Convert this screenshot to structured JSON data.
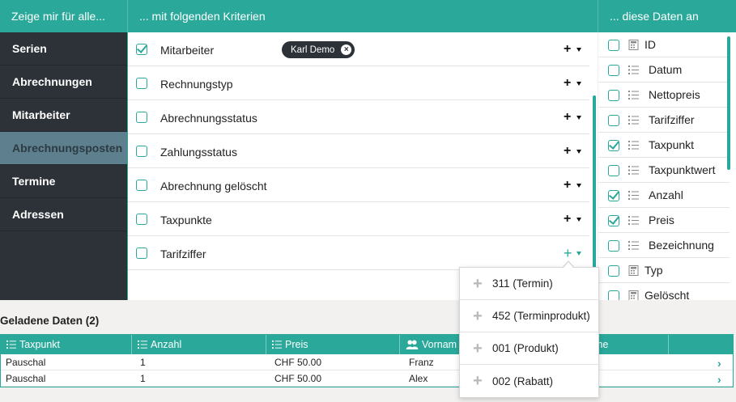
{
  "header": {
    "col1": "Zeige mir für alle...",
    "col2": "... mit folgenden Kriterien",
    "col3": "... diese Daten an"
  },
  "nav": [
    "Serien",
    "Abrechnungen",
    "Mitarbeiter",
    "Abrechnungsposten",
    "Termine",
    "Adressen"
  ],
  "nav_active": "Abrechnungsposten",
  "criteria": [
    {
      "label": "Mitarbeiter",
      "checked": true,
      "chip": "Karl Demo"
    },
    {
      "label": "Rechnungstyp",
      "checked": false
    },
    {
      "label": "Abrechnungsstatus",
      "checked": false
    },
    {
      "label": "Zahlungsstatus",
      "checked": false
    },
    {
      "label": "Abrechnung gelöscht",
      "checked": false
    },
    {
      "label": "Taxpunkte",
      "checked": false
    },
    {
      "label": "Tarifziffer",
      "checked": false
    }
  ],
  "fields": [
    {
      "label": "ID",
      "checked": false,
      "icon": "calculator-icon"
    },
    {
      "label": "Datum",
      "checked": false,
      "icon": "list-icon"
    },
    {
      "label": "Nettopreis",
      "checked": false,
      "icon": "list-icon"
    },
    {
      "label": "Tarifziffer",
      "checked": false,
      "icon": "list-icon"
    },
    {
      "label": "Taxpunkt",
      "checked": true,
      "icon": "list-icon"
    },
    {
      "label": "Taxpunktwert",
      "checked": false,
      "icon": "list-icon"
    },
    {
      "label": "Anzahl",
      "checked": true,
      "icon": "list-icon"
    },
    {
      "label": "Preis",
      "checked": true,
      "icon": "list-icon"
    },
    {
      "label": "Bezeichnung",
      "checked": false,
      "icon": "list-icon"
    },
    {
      "label": "Typ",
      "checked": false,
      "icon": "calculator-icon"
    },
    {
      "label": "Gelöscht",
      "checked": false,
      "icon": "calculator-icon"
    }
  ],
  "dropdown": [
    "311 (Termin)",
    "452 (Terminprodukt)",
    "001 (Produkt)",
    "002 (Rabatt)"
  ],
  "loaded": {
    "title": "Geladene Daten (2)",
    "columns": [
      "Taxpunkt",
      "Anzahl",
      "Preis",
      "Vornam",
      "me"
    ],
    "rows": [
      [
        "Pauschal",
        "1",
        "CHF 50.00",
        "Franz"
      ],
      [
        "Pauschal",
        "1",
        "CHF 50.00",
        "Alex"
      ]
    ]
  },
  "colors": {
    "accent": "#2aa89a",
    "nav_bg": "#2c3238",
    "nav_active": "#5e7f8e"
  }
}
